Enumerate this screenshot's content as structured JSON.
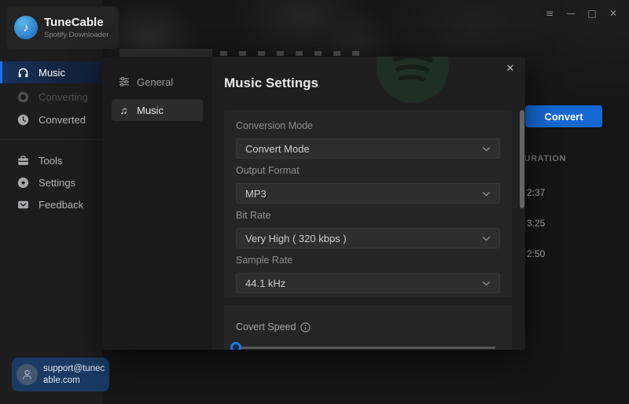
{
  "app": {
    "name": "TuneCable",
    "subtitle": "Spotify Downloader"
  },
  "window_controls": {
    "menu": "≡",
    "minimize": "—",
    "maximize": "□",
    "close": "✕"
  },
  "sidebar": {
    "items": [
      {
        "label": "Music"
      },
      {
        "label": "Converting"
      },
      {
        "label": "Converted"
      },
      {
        "label": "Tools"
      },
      {
        "label": "Settings"
      },
      {
        "label": "Feedback"
      }
    ],
    "support_email": "support@tunecable.com"
  },
  "background": {
    "convert_button": "Convert",
    "duration_header": "DURATION",
    "durations": [
      "2:37",
      "3:25",
      "2:50"
    ]
  },
  "modal": {
    "title": "Music Settings",
    "close_glyph": "✕",
    "tabs": [
      {
        "label": "General"
      },
      {
        "label": "Music"
      }
    ],
    "fields": [
      {
        "label": "Conversion Mode",
        "value": "Convert Mode"
      },
      {
        "label": "Output Format",
        "value": "MP3"
      },
      {
        "label": "Bit Rate",
        "value": "Very High ( 320 kbps )"
      },
      {
        "label": "Sample Rate",
        "value": "44.1 kHz"
      }
    ],
    "speed": {
      "label": "Covert Speed",
      "percent": 0
    }
  },
  "colors": {
    "accent_blue": "#1568d4",
    "spotify_green": "#1ed760"
  }
}
